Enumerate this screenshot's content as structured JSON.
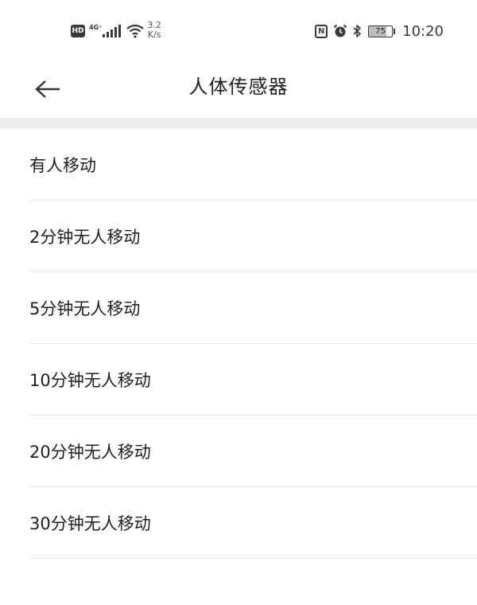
{
  "status_bar": {
    "hd_badge": "HD",
    "network_type": "4G⁺",
    "speed_value": "3.2",
    "speed_unit": "K/s",
    "nfc_letter": "N",
    "battery_level": "75",
    "battery_percent": 75,
    "time": "10:20",
    "icons": [
      "signal-icon",
      "wifi-icon",
      "nfc-icon",
      "alarm-icon",
      "bluetooth-icon",
      "battery-icon"
    ]
  },
  "header": {
    "back_icon": "arrow-left-icon",
    "title": "人体传感器"
  },
  "options": [
    {
      "label": "有人移动"
    },
    {
      "label": "2分钟无人移动"
    },
    {
      "label": "5分钟无人移动"
    },
    {
      "label": "10分钟无人移动"
    },
    {
      "label": "20分钟无人移动"
    },
    {
      "label": "30分钟无人移动"
    }
  ],
  "colors": {
    "background": "#ffffff",
    "divider": "#e6e6e6",
    "section_gap": "#eeeeee",
    "text": "#1f1f1f",
    "status_icon": "#3a3a3a"
  }
}
